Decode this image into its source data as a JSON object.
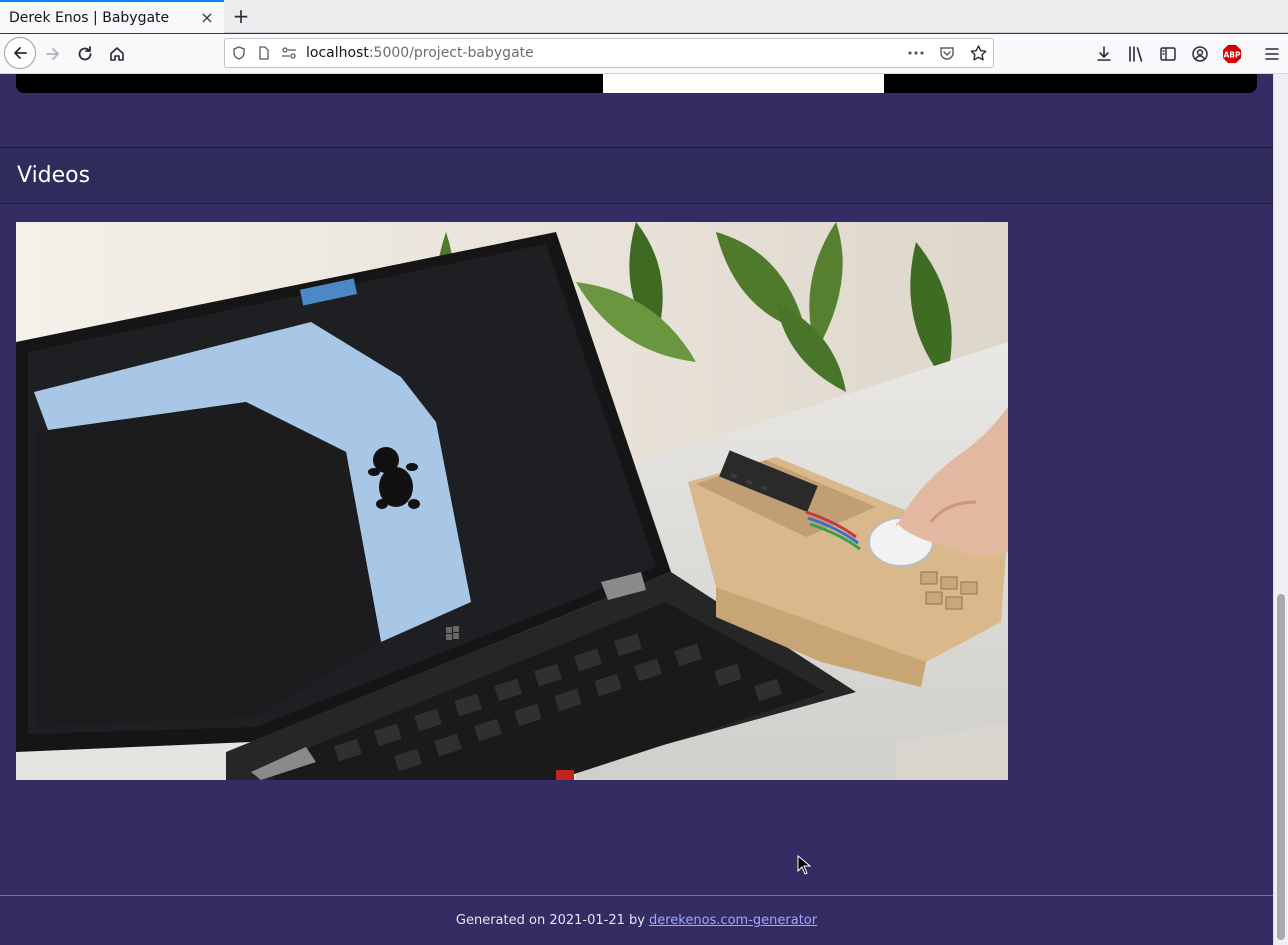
{
  "browser": {
    "tab_title": "Derek Enos | Babygate",
    "url_host": "localhost",
    "url_path": ":5000/project-babygate",
    "new_tab_label": "+",
    "close_tab_label": "×"
  },
  "section": {
    "title": "Videos"
  },
  "footer": {
    "prefix": "Generated on 2021-01-21 by",
    "link_text": "derekenos.com-generator"
  },
  "icons": {
    "back": "arrow-left-icon",
    "forward": "arrow-right-icon",
    "reload": "reload-icon",
    "home": "home-icon",
    "shield": "tracking-shield-icon",
    "page": "page-icon",
    "permissions": "permissions-icon",
    "more": "more-actions-icon",
    "pocket": "pocket-icon",
    "bookmark": "star-icon",
    "downloads": "download-icon",
    "library": "library-icon",
    "sidebar": "sidebar-icon",
    "account": "account-icon",
    "adblock": "abp-icon",
    "menu": "hamburger-menu-icon"
  },
  "colors": {
    "page_background": "#332d63",
    "section_header": "#2f2b5a",
    "link": "#9fa8ff",
    "tab_accent": "#0a84ff"
  }
}
